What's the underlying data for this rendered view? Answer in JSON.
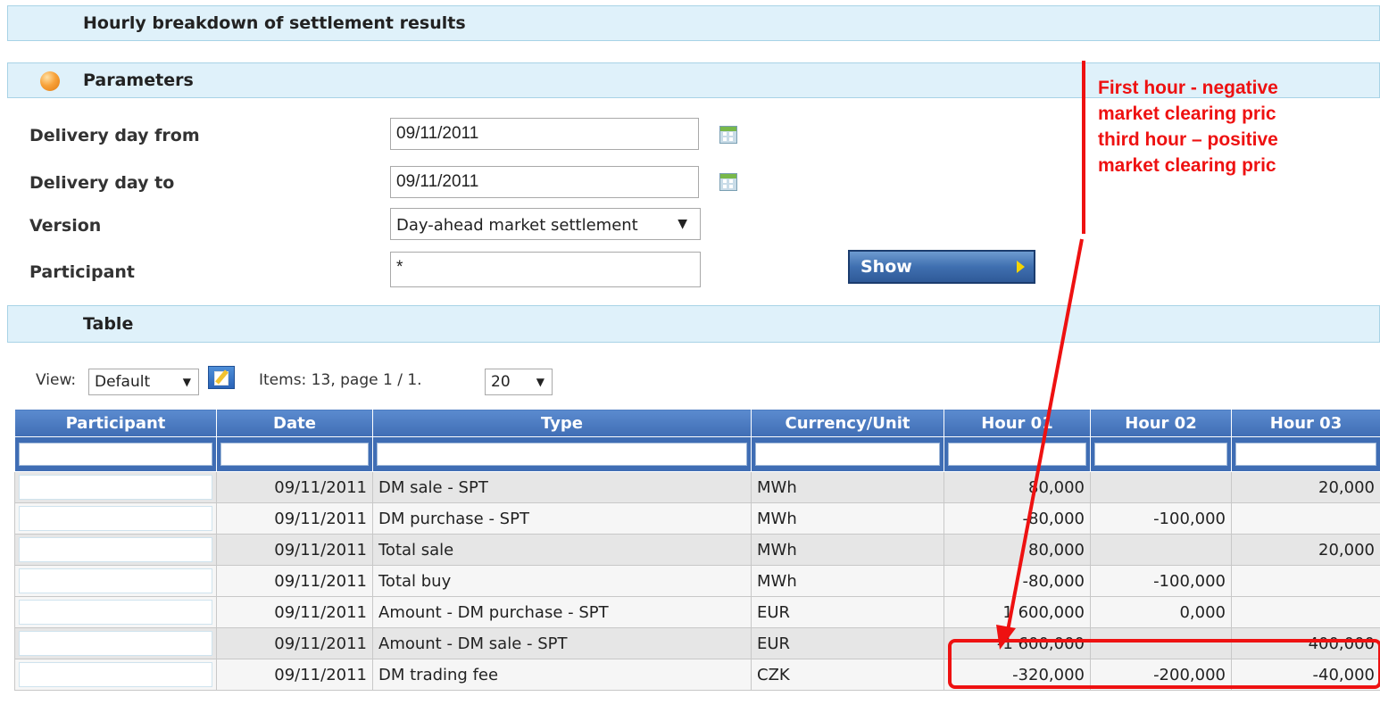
{
  "header": {
    "title": "Hourly breakdown of settlement results"
  },
  "parameters": {
    "title": "Parameters",
    "delivery_from_label": "Delivery day from",
    "delivery_from_value": "09/11/2011",
    "delivery_to_label": "Delivery day to",
    "delivery_to_value": "09/11/2011",
    "version_label": "Version",
    "version_value": "Day-ahead market settlement",
    "participant_label": "Participant",
    "participant_value": "*",
    "show_label": "Show"
  },
  "table_section": {
    "title": "Table"
  },
  "toolbar": {
    "view_label": "View:",
    "view_value": "Default",
    "items_text": "Items: 13, page 1 / 1.",
    "page_size": "20"
  },
  "table": {
    "columns": [
      "Participant",
      "Date",
      "Type",
      "Currency/Unit",
      "Hour 01",
      "Hour 02",
      "Hour 03"
    ],
    "rows": [
      {
        "date": "09/11/2011",
        "type": "DM sale - SPT",
        "unit": "MWh",
        "h1": "80,000",
        "h2": "",
        "h3": "20,000"
      },
      {
        "date": "09/11/2011",
        "type": "DM purchase - SPT",
        "unit": "MWh",
        "h1": "-80,000",
        "h2": "-100,000",
        "h3": ""
      },
      {
        "date": "09/11/2011",
        "type": "Total sale",
        "unit": "MWh",
        "h1": "80,000",
        "h2": "",
        "h3": "20,000"
      },
      {
        "date": "09/11/2011",
        "type": "Total buy",
        "unit": "MWh",
        "h1": "-80,000",
        "h2": "-100,000",
        "h3": ""
      },
      {
        "date": "09/11/2011",
        "type": "Amount - DM purchase - SPT",
        "unit": "EUR",
        "h1": "1 600,000",
        "h2": "0,000",
        "h3": ""
      },
      {
        "date": "09/11/2011",
        "type": "Amount - DM sale - SPT",
        "unit": "EUR",
        "h1": "-1 600,000",
        "h2": "",
        "h3": "400,000"
      },
      {
        "date": "09/11/2011",
        "type": "DM trading fee",
        "unit": "CZK",
        "h1": "-320,000",
        "h2": "-200,000",
        "h3": "-40,000"
      }
    ]
  },
  "annotation": {
    "lines": [
      "First hour - negative",
      "market clearing pric",
      "third hour – positive",
      "market clearing pric"
    ],
    "color": "#ee1111"
  },
  "colors": {
    "header_bg": "#dff1fa",
    "table_header": "#4a7bc2",
    "accent_red": "#ee1111"
  },
  "icons": {
    "parameters": "orange-orb-icon",
    "calendar": "calendar-icon",
    "edit": "edit-view-icon"
  }
}
